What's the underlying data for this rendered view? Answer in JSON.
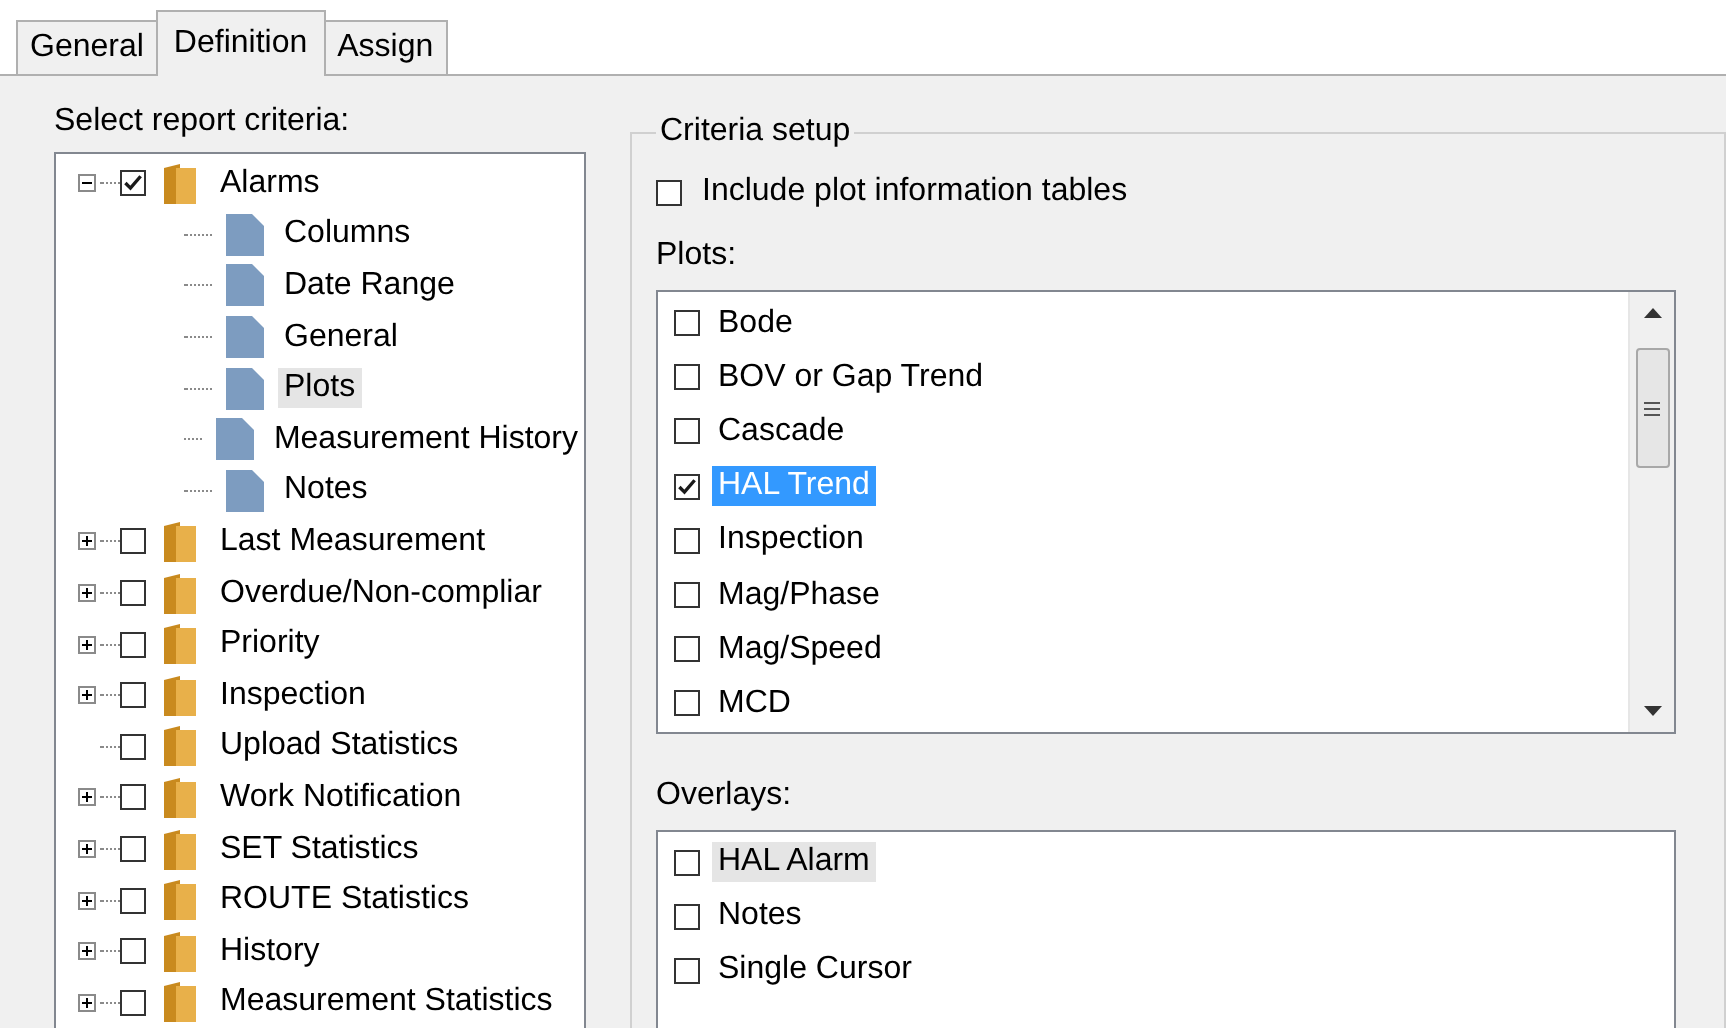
{
  "tabs": [
    {
      "label": "General",
      "selected": false
    },
    {
      "label": "Definition",
      "selected": true
    },
    {
      "label": "Assign",
      "selected": false
    }
  ],
  "criteria_label": "Select report criteria:",
  "tree": [
    {
      "kind": "folder",
      "label": "Alarms",
      "checked": true,
      "expanded": true,
      "selected": false,
      "children": [
        {
          "kind": "page",
          "label": "Columns",
          "selected": false
        },
        {
          "kind": "page",
          "label": "Date Range",
          "selected": false
        },
        {
          "kind": "page",
          "label": "General",
          "selected": false
        },
        {
          "kind": "page",
          "label": "Plots",
          "selected": true
        },
        {
          "kind": "page",
          "label": "Measurement History",
          "selected": false
        },
        {
          "kind": "page",
          "label": "Notes",
          "selected": false
        }
      ]
    },
    {
      "kind": "folder",
      "label": "Last Measurement",
      "checked": false,
      "expanded": false,
      "selected": false
    },
    {
      "kind": "folder",
      "label": "Overdue/Non-compliar",
      "checked": false,
      "expanded": false,
      "selected": false
    },
    {
      "kind": "folder",
      "label": "Priority",
      "checked": false,
      "expanded": false,
      "selected": false
    },
    {
      "kind": "folder",
      "label": "Inspection",
      "checked": false,
      "expanded": false,
      "selected": false
    },
    {
      "kind": "leaf-folder",
      "label": "Upload Statistics",
      "checked": false,
      "selected": false
    },
    {
      "kind": "folder",
      "label": "Work Notification",
      "checked": false,
      "expanded": false,
      "selected": false
    },
    {
      "kind": "folder",
      "label": "SET Statistics",
      "checked": false,
      "expanded": false,
      "selected": false
    },
    {
      "kind": "folder",
      "label": "ROUTE Statistics",
      "checked": false,
      "expanded": false,
      "selected": false
    },
    {
      "kind": "folder",
      "label": "History",
      "checked": false,
      "expanded": false,
      "selected": false
    },
    {
      "kind": "folder",
      "label": "Measurement Statistics",
      "checked": false,
      "expanded": false,
      "selected": false
    }
  ],
  "criteria_setup": {
    "title": "Criteria setup",
    "include_tables": {
      "label": "Include plot information tables",
      "checked": false
    },
    "plots": {
      "label": "Plots:",
      "focused": true,
      "items": [
        {
          "label": "Bode",
          "checked": false,
          "selected": false
        },
        {
          "label": "BOV or Gap Trend",
          "checked": false,
          "selected": false
        },
        {
          "label": "Cascade",
          "checked": false,
          "selected": false
        },
        {
          "label": "HAL Trend",
          "checked": true,
          "selected": true
        },
        {
          "label": "Inspection",
          "checked": false,
          "selected": false
        },
        {
          "label": "Mag/Phase",
          "checked": false,
          "selected": false
        },
        {
          "label": "Mag/Speed",
          "checked": false,
          "selected": false
        },
        {
          "label": "MCD",
          "checked": false,
          "selected": false
        }
      ]
    },
    "overlays": {
      "label": "Overlays:",
      "focused": false,
      "items": [
        {
          "label": "HAL Alarm",
          "checked": false,
          "selected": true
        },
        {
          "label": "Notes",
          "checked": false,
          "selected": false
        },
        {
          "label": "Single Cursor",
          "checked": false,
          "selected": false
        }
      ]
    }
  }
}
